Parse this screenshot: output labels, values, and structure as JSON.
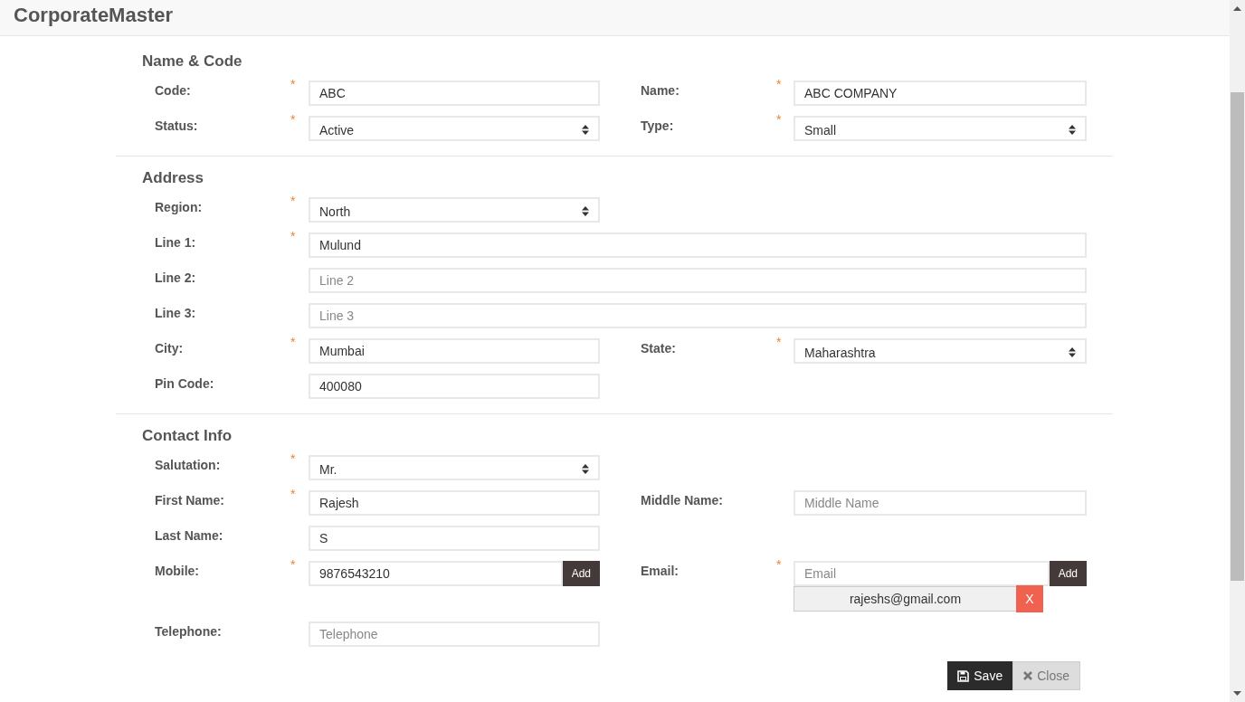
{
  "header": {
    "title": "CorporateMaster"
  },
  "sections": [
    {
      "title": "Name & Code",
      "rows": [
        [
          {
            "kind": "text",
            "label": "Code:",
            "required_mark": "*",
            "value": "ABC"
          },
          {
            "kind": "text",
            "label": "Name:",
            "required_mark": "*",
            "value": "ABC COMPANY"
          }
        ],
        [
          {
            "kind": "select",
            "label": "Status:",
            "required_mark": "*",
            "value": "Active"
          },
          {
            "kind": "select",
            "label": "Type:",
            "required_mark": "*",
            "value": "Small"
          }
        ]
      ]
    },
    {
      "title": "Address",
      "rows": [
        [
          {
            "kind": "select",
            "label": "Region:",
            "required_mark": "*",
            "value": "North"
          }
        ],
        [
          {
            "kind": "wide",
            "label": "Line 1:",
            "required_mark": "*",
            "value": "Mulund"
          }
        ],
        [
          {
            "kind": "wide",
            "label": "Line 2:",
            "placeholder": "Line 2"
          }
        ],
        [
          {
            "kind": "wide",
            "label": "Line 3:",
            "placeholder": "Line 3"
          }
        ],
        [
          {
            "kind": "text",
            "label": "City:",
            "required_mark": "*",
            "value": "Mumbai"
          },
          {
            "kind": "select",
            "label": "State:",
            "required_mark": "*",
            "value": "Maharashtra"
          }
        ],
        [
          {
            "kind": "text",
            "label": "Pin Code:",
            "value": "400080"
          }
        ]
      ]
    },
    {
      "title": "Contact Info",
      "rows": [
        [
          {
            "kind": "select",
            "label": "Salutation:",
            "required_mark": "*",
            "value": "Mr."
          }
        ],
        [
          {
            "kind": "text",
            "label": "First Name:",
            "required_mark": "*",
            "value": "Rajesh"
          },
          {
            "kind": "text",
            "label": "Middle Name:",
            "placeholder": "Middle Name"
          }
        ],
        [
          {
            "kind": "text",
            "label": "Last Name:",
            "value": "S"
          }
        ],
        [
          {
            "kind": "add",
            "label": "Mobile:",
            "required_mark": "*",
            "value": "9876543210",
            "button": "Add"
          },
          {
            "kind": "add",
            "label": "Email:",
            "required_mark": "*",
            "placeholder": "Email",
            "button": "Add",
            "entries": [
              {
                "text": "rajeshs@gmail.com",
                "remove": "X"
              }
            ]
          }
        ],
        [
          {
            "kind": "text",
            "label": "Telephone:",
            "placeholder": "Telephone"
          }
        ]
      ]
    }
  ],
  "actions": {
    "save": "Save",
    "close": "Close"
  }
}
